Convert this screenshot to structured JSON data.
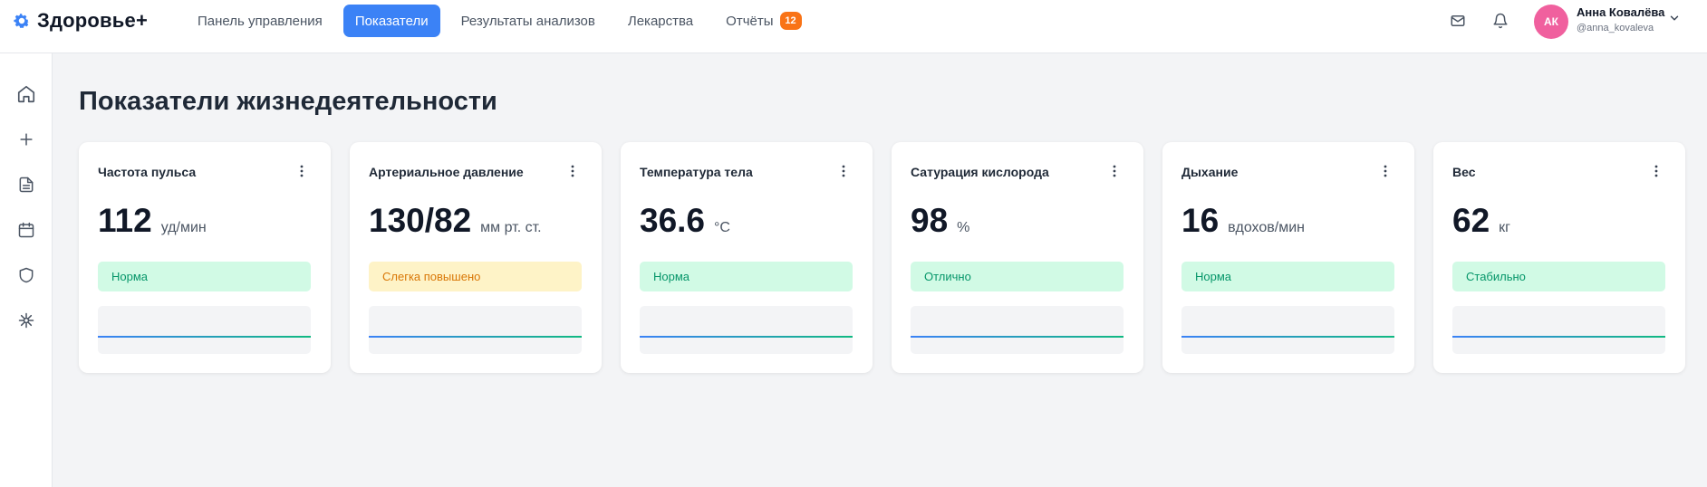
{
  "app": {
    "name": "Здоровье+",
    "accent": "#3b82f6"
  },
  "nav": {
    "items": [
      {
        "label": "Панель управления",
        "active": false
      },
      {
        "label": "Показатели",
        "active": true
      },
      {
        "label": "Результаты анализов",
        "active": false
      },
      {
        "label": "Лекарства",
        "active": false
      },
      {
        "label": "Отчёты",
        "active": false,
        "badge": "12"
      }
    ]
  },
  "header_icons": [
    "mail-icon",
    "bell-icon"
  ],
  "user": {
    "initials": "АК",
    "name": "Анна Ковалёва",
    "handle": "@anna_kovaleva",
    "avatar_color": "#f0609e"
  },
  "sidebar": {
    "icons": [
      "home-icon",
      "plus-icon",
      "document-icon",
      "calendar-icon",
      "shield-icon",
      "virus-icon"
    ]
  },
  "page": {
    "title": "Показатели жизнедеятельности"
  },
  "cards": [
    {
      "title": "Частота пульса",
      "value": "112",
      "unit": "уд/мин",
      "status": "Норма",
      "status_type": "ok"
    },
    {
      "title": "Артериальное давление",
      "value": "130/82",
      "unit": "мм рт. ст.",
      "status": "Слегка повышено",
      "status_type": "warn"
    },
    {
      "title": "Температура тела",
      "value": "36.6",
      "unit": "°C",
      "status": "Норма",
      "status_type": "ok"
    },
    {
      "title": "Сатурация кислорода",
      "value": "98",
      "unit": "%",
      "status": "Отлично",
      "status_type": "ok"
    },
    {
      "title": "Дыхание",
      "value": "16",
      "unit": "вдохов/мин",
      "status": "Норма",
      "status_type": "ok"
    },
    {
      "title": "Вес",
      "value": "62",
      "unit": "кг",
      "status": "Стабильно",
      "status_type": "ok"
    }
  ],
  "colors": {
    "status_ok_bg": "#d1fae5",
    "status_ok_text": "#059669",
    "status_warn_bg": "#fef3c7",
    "status_warn_text": "#d97706",
    "spark_start": "#3b82f6",
    "spark_end": "#10b981"
  }
}
